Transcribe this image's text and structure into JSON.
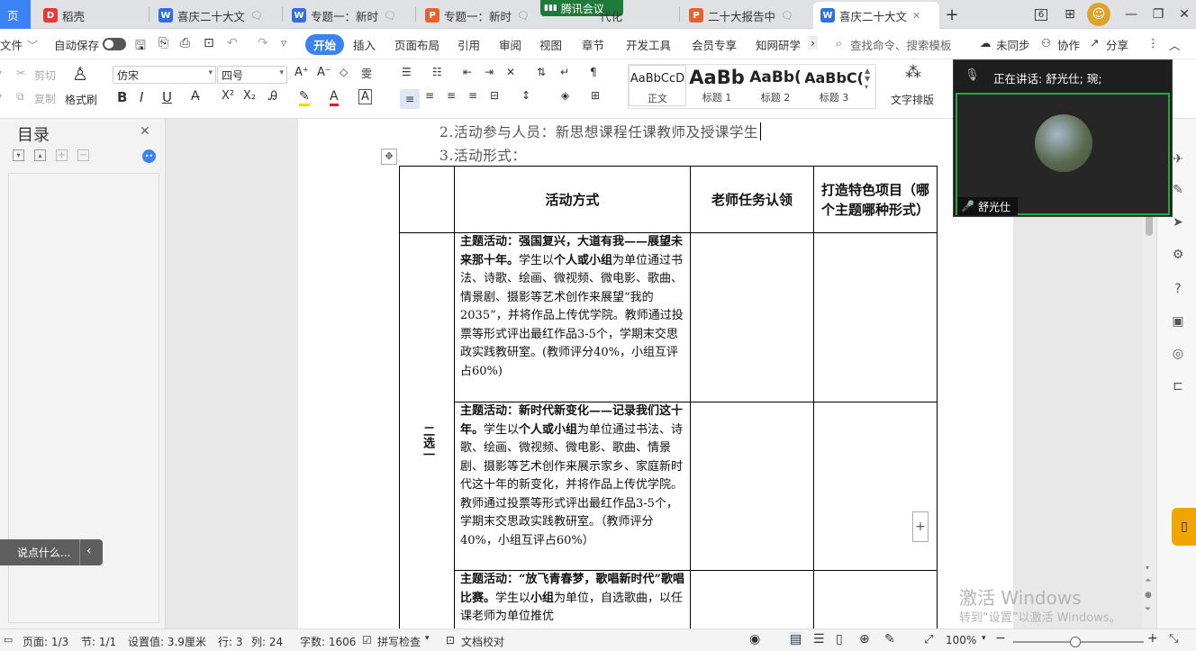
{
  "tabs": [
    {
      "label": "页",
      "icon": "home-icon"
    },
    {
      "label": "稻壳",
      "icon": "docer-icon"
    },
    {
      "label": "喜庆二十大文",
      "icon": "word-doc-icon"
    },
    {
      "label": "专题一：新时",
      "icon": "word-doc-icon"
    },
    {
      "label": "专题一：新时",
      "icon": "ppt-doc-icon"
    },
    {
      "label": "腾讯会议",
      "icon": "tencent-meeting-icon"
    },
    {
      "label": "代化",
      "icon": "ppt-doc-icon"
    },
    {
      "label": "二十大报告中",
      "icon": "ppt-doc-icon"
    },
    {
      "label": "喜庆二十大文",
      "icon": "word-doc-icon"
    }
  ],
  "window": {
    "badge": "6"
  },
  "menu": {
    "file": "文件",
    "autosave": "自动保存",
    "items": [
      "开始",
      "插入",
      "页面布局",
      "引用",
      "审阅",
      "视图",
      "章节",
      "开发工具",
      "会员专享",
      "知网研学"
    ],
    "search_placeholder": "查找命令、搜索模板",
    "sync": "未同步",
    "collab": "协作",
    "share": "分享"
  },
  "ribbon": {
    "cut": "剪切",
    "copy": "复制",
    "format_painter": "格式刷",
    "font_name": "仿宋",
    "font_size": "四号",
    "styles": [
      {
        "preview": "AaBbCcD",
        "name": "正文"
      },
      {
        "preview": "AaBb",
        "name": "标题 1"
      },
      {
        "preview": "AaBb(",
        "name": "标题 2"
      },
      {
        "preview": "AaBbC(",
        "name": "标题 3"
      }
    ],
    "text_layout": "文字排版"
  },
  "toc": {
    "title": "目录"
  },
  "document": {
    "line1": "2.活动参与人员：新思想课程任课教师及授课学生",
    "line2": "3.活动形式：",
    "header": [
      "活动方式",
      "老师任务认领",
      "打造特色项目（哪个主题哪种形式）"
    ],
    "side_label": "二选一",
    "rows": [
      {
        "bold": "主题活动：强国复兴，大道有我——展望未来那十年。",
        "text_a": "学生以",
        "bold_b": "个人或小组",
        "text_b": "为单位通过书法、诗歌、绘画、微视频、微电影、歌曲、情景剧、摄影等艺术创作来展望“我的2035”，并将作品上传优学院。教师通过投票等形式评出最红作品3-5个，学期末交思政实践教研室。(教师评分40%，小组互评占60%)"
      },
      {
        "bold": "主题活动：新时代新变化——记录我们这十年。",
        "text_a": "学生以",
        "bold_b": "个人或小组",
        "text_b": "为单位通过书法、诗歌、绘画、微视频、微电影、歌曲、情景剧、摄影等艺术创作来展示家乡、家庭新时代这十年的新变化，并将作品上传优学院。教师通过投票等形式评出最红作品3-5个，学期末交思政实践教研室。（教师评分40%，小组互评占60%）"
      },
      {
        "bold": "主题活动：“放飞青春梦，歌唱新时代”歌唱比赛。",
        "text_a": "学生以",
        "bold_b": "小组",
        "text_b": "为单位，自选歌曲，以任课老师为单位推优"
      }
    ]
  },
  "meeting": {
    "speaking": "正在讲话: 舒光仕; 琬;",
    "name": "舒光仕"
  },
  "float": {
    "say": "说点什么..."
  },
  "watermark": {
    "line1": "激活 Windows",
    "line2": "转到“设置”以激活 Windows。"
  },
  "status": {
    "page": "页面: 1/3",
    "section": "节: 1/1",
    "setting": "设置值: 3.9厘米",
    "row": "行: 3",
    "col": "列: 24",
    "words": "字数: 1606",
    "spell": "拼写检查",
    "proof": "文档校对",
    "zoom": "100%"
  }
}
